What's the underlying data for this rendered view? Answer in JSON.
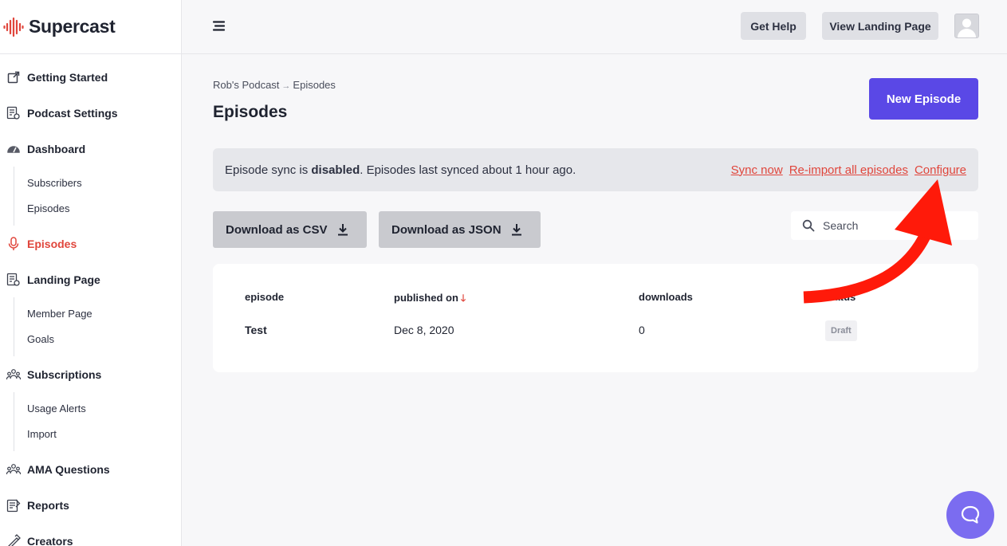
{
  "brand": {
    "name": "Supercast",
    "logo_icon": "supercast-logo-icon",
    "accent": "#e0463c"
  },
  "sidebar": {
    "items": [
      {
        "label": "Getting Started",
        "icon": "external-link-icon"
      },
      {
        "label": "Podcast Settings",
        "icon": "podcast-settings-icon"
      },
      {
        "label": "Dashboard",
        "icon": "gauge-icon",
        "children": [
          "Subscribers",
          "Episodes"
        ]
      },
      {
        "label": "Episodes",
        "icon": "microphone-icon",
        "active": true
      },
      {
        "label": "Landing Page",
        "icon": "landing-page-icon",
        "children": [
          "Member Page",
          "Goals"
        ]
      },
      {
        "label": "Subscriptions",
        "icon": "users-icon",
        "children": [
          "Usage Alerts",
          "Import"
        ]
      },
      {
        "label": "AMA Questions",
        "icon": "users-icon"
      },
      {
        "label": "Reports",
        "icon": "reports-icon"
      },
      {
        "label": "Creators",
        "icon": "creators-icon"
      }
    ]
  },
  "topbar": {
    "help_label": "Get Help",
    "landing_label": "View Landing Page",
    "menu_icon": "hamburger-icon",
    "avatar_icon": "avatar-icon"
  },
  "main": {
    "breadcrumb": {
      "parent": "Rob's Podcast",
      "separator": "→",
      "current": "Episodes"
    },
    "title": "Episodes",
    "new_episode_label": "New Episode",
    "new_episode_color": "#5a48e6",
    "sync": {
      "prefix": "Episode sync is ",
      "status": "disabled",
      "suffix": ". Episodes last synced about 1 hour ago.",
      "links": [
        "Sync now",
        "Re-import all episodes",
        "Configure"
      ]
    },
    "download_csv_label": "Download as CSV",
    "download_json_label": "Download as JSON",
    "search_placeholder": "Search",
    "table": {
      "columns": [
        "episode",
        "published on",
        "downloads",
        "status"
      ],
      "rows": [
        {
          "episode": "Test",
          "published_on": "Dec 8, 2020",
          "downloads": "0",
          "status": "Draft"
        }
      ]
    }
  },
  "annotation": {
    "arrow_color": "#ff1a0a",
    "points_to": "Configure"
  },
  "chat": {
    "icon": "chat-bubble-icon",
    "color": "#7b6cf0"
  }
}
